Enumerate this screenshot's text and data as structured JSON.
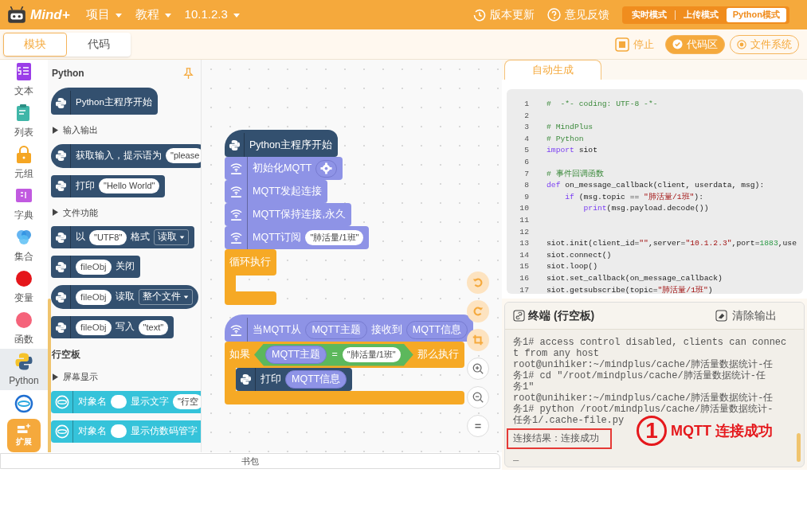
{
  "header": {
    "logo": "Mind+",
    "menus": [
      "项目",
      "教程",
      "10.1.2.3"
    ],
    "actions": [
      {
        "label": "版本更新",
        "kind": "update"
      },
      {
        "label": "意见反馈",
        "kind": "feedback"
      }
    ],
    "modes": [
      {
        "label": "实时模式",
        "selected": false
      },
      {
        "label": "上传模式",
        "selected": false
      },
      {
        "label": "Python模式",
        "selected": true
      }
    ]
  },
  "view_tabs": [
    {
      "label": "模块",
      "selected": true
    },
    {
      "label": "代码",
      "selected": false
    }
  ],
  "toolbar": [
    {
      "label": "停止",
      "kind": "stop",
      "selected": false
    },
    {
      "label": "代码区",
      "kind": "check",
      "selected": true
    },
    {
      "label": "文件系统",
      "kind": "radio",
      "selected": false
    }
  ],
  "categories": [
    {
      "label": "文本",
      "kind": "text",
      "selected": false
    },
    {
      "label": "列表",
      "kind": "list",
      "selected": false
    },
    {
      "label": "元组",
      "kind": "tuple",
      "selected": false
    },
    {
      "label": "字典",
      "kind": "dict",
      "selected": false
    },
    {
      "label": "集合",
      "kind": "set",
      "selected": false
    },
    {
      "label": "变量",
      "kind": "variable",
      "selected": false
    },
    {
      "label": "函数",
      "kind": "function",
      "selected": false
    },
    {
      "label": "Python",
      "kind": "python",
      "selected": true
    },
    {
      "kind": "unihiker",
      "selected": false
    },
    {
      "label": "扩展",
      "kind": "extension",
      "selected": false
    }
  ],
  "palette": [
    {
      "kind": "heading",
      "text": "Python",
      "pin": true
    },
    {
      "kind": "python-hat",
      "parts": [
        {
          "kind": "text",
          "text": "Python主程序开始"
        }
      ]
    },
    {
      "kind": "section",
      "text": "输入输出"
    },
    {
      "kind": "python-reporter",
      "parts": [
        {
          "kind": "text",
          "text": "获取输入，提示语为"
        },
        {
          "kind": "str",
          "text": "\"please"
        }
      ]
    },
    {
      "kind": "python-stack",
      "parts": [
        {
          "kind": "text",
          "text": "打印"
        },
        {
          "kind": "str",
          "text": "\"Hello World\""
        }
      ]
    },
    {
      "kind": "section",
      "text": "文件功能"
    },
    {
      "kind": "python-stack",
      "parts": [
        {
          "kind": "text",
          "text": "以"
        },
        {
          "kind": "str",
          "text": "\"UTF8\""
        },
        {
          "kind": "text",
          "text": "格式"
        },
        {
          "kind": "dropdown",
          "text": "读取"
        }
      ]
    },
    {
      "kind": "python-stack",
      "parts": [
        {
          "kind": "var",
          "text": "fileObj"
        },
        {
          "kind": "text",
          "text": "关闭"
        }
      ]
    },
    {
      "kind": "python-reporter",
      "parts": [
        {
          "kind": "var",
          "text": "fileObj"
        },
        {
          "kind": "text",
          "text": "读取"
        },
        {
          "kind": "dropdown",
          "text": "整个文件"
        }
      ]
    },
    {
      "kind": "python-stack",
      "parts": [
        {
          "kind": "var",
          "text": "fileObj"
        },
        {
          "kind": "text",
          "text": "写入"
        },
        {
          "kind": "str",
          "text": "\"text\""
        }
      ]
    },
    {
      "kind": "heading",
      "text": "行空板",
      "pin": false
    },
    {
      "kind": "section",
      "text": "屏幕显示"
    },
    {
      "kind": "unihiker-stack",
      "parts": [
        {
          "kind": "text",
          "text": "对象名"
        },
        {
          "kind": "slot"
        },
        {
          "kind": "text",
          "text": "显示文字"
        },
        {
          "kind": "str",
          "text": "\"行空"
        }
      ]
    },
    {
      "kind": "unihiker-stack",
      "parts": [
        {
          "kind": "text",
          "text": "对象名"
        },
        {
          "kind": "slot"
        },
        {
          "kind": "text",
          "text": "显示仿数码管字"
        }
      ]
    }
  ],
  "workspace": [
    [
      {
        "kind": "python-hat",
        "parts": [
          {
            "kind": "text",
            "text": "Python主程序开始"
          }
        ]
      },
      {
        "kind": "mqtt-stack",
        "parts": [
          {
            "kind": "text",
            "text": "初始化MQTT"
          },
          {
            "kind": "gear"
          }
        ]
      },
      {
        "kind": "mqtt-stack",
        "parts": [
          {
            "kind": "text",
            "text": "MQTT发起连接"
          }
        ]
      },
      {
        "kind": "mqtt-stack",
        "parts": [
          {
            "kind": "text",
            "text": "MQTT保持连接,永久"
          }
        ]
      },
      {
        "kind": "mqtt-stack",
        "parts": [
          {
            "kind": "text",
            "text": "MQTT订阅"
          },
          {
            "kind": "str",
            "text": "\"肺活量/1班\""
          }
        ]
      },
      {
        "kind": "control-c",
        "parts": [
          {
            "kind": "text",
            "text": "循环执行"
          }
        ]
      }
    ],
    [
      {
        "kind": "mqtt-hat",
        "parts": [
          {
            "kind": "text",
            "text": "当MQTT从"
          },
          {
            "kind": "mvar",
            "text": "MQTT主题"
          },
          {
            "kind": "text",
            "text": "接收到"
          },
          {
            "kind": "mvar",
            "text": "MQTT信息"
          }
        ]
      },
      {
        "kind": "control-c",
        "parts": [
          {
            "kind": "text",
            "text": "如果"
          },
          {
            "kind": "cond",
            "parts": [
              {
                "kind": "mvar",
                "text": "MQTT主题"
              },
              {
                "kind": "text",
                "text": "="
              },
              {
                "kind": "str",
                "text": "\"肺活量/1班\""
              }
            ]
          },
          {
            "kind": "text",
            "text": "那么执行"
          }
        ],
        "children": [
          {
            "kind": "python-stack",
            "parts": [
              {
                "kind": "text",
                "text": "打印"
              },
              {
                "kind": "mvar",
                "text": "MQTT信息"
              }
            ]
          }
        ]
      }
    ]
  ],
  "canvas_tools": [
    {
      "kind": "undo"
    },
    {
      "kind": "redo"
    },
    {
      "kind": "crop"
    },
    {
      "kind": "zoom-in"
    },
    {
      "kind": "zoom-out"
    },
    {
      "kind": "reset"
    }
  ],
  "code_panel": {
    "tab": "自动生成",
    "lines": [
      {
        "no": "1",
        "code": [
          {
            "text": "#  -*- coding: UTF-8 -*-",
            "kind": "cm"
          }
        ]
      },
      {
        "no": "2"
      },
      {
        "no": "3",
        "code": [
          {
            "text": "# MindPlus",
            "kind": "cm"
          }
        ]
      },
      {
        "no": "4",
        "code": [
          {
            "text": "# Python",
            "kind": "cm"
          }
        ]
      },
      {
        "no": "5",
        "code": [
          {
            "text": "import",
            "kind": "kw"
          },
          {
            "text": " siot"
          }
        ]
      },
      {
        "no": "6"
      },
      {
        "no": "7",
        "code": [
          {
            "text": "# 事件回调函数",
            "kind": "cm"
          }
        ]
      },
      {
        "no": "8",
        "code": [
          {
            "text": "def",
            "kind": "kw"
          },
          {
            "text": " on_message_callback(client, userdata, msg):"
          }
        ]
      },
      {
        "no": "9",
        "code": [
          {
            "text": "    if",
            "kind": "kw"
          },
          {
            "text": " (msg.topic == "
          },
          {
            "text": "\"肺活量/1班\"",
            "kind": "str"
          },
          {
            "text": "):"
          }
        ]
      },
      {
        "no": "10",
        "code": [
          {
            "text": "        print",
            "kind": "kw"
          },
          {
            "text": "(msg.payload.decode())"
          }
        ]
      },
      {
        "no": "11"
      },
      {
        "no": "12"
      },
      {
        "no": "13",
        "code": [
          {
            "text": "siot.init(client_id="
          },
          {
            "text": "\"\"",
            "kind": "str"
          },
          {
            "text": ",server="
          },
          {
            "text": "\"10.1.2.3\"",
            "kind": "str"
          },
          {
            "text": ",port="
          },
          {
            "text": "1883",
            "kind": "num"
          },
          {
            "text": ",use"
          }
        ]
      },
      {
        "no": "14",
        "code": [
          {
            "text": "siot.connect()"
          }
        ]
      },
      {
        "no": "15",
        "code": [
          {
            "text": "siot.loop()"
          }
        ]
      },
      {
        "no": "16",
        "code": [
          {
            "text": "siot.set_callback(on_message_callback)"
          }
        ]
      },
      {
        "no": "17",
        "code": [
          {
            "text": "siot.getsubscribe(topic="
          },
          {
            "text": "\"肺活量/1班\"",
            "kind": "str"
          },
          {
            "text": ")"
          }
        ]
      }
    ]
  },
  "terminal": {
    "title": "终端 (行空板)",
    "clear": "清除输出",
    "lines": [
      {
        "text": "务1# access control disabled, clients can connec",
        "highlighted": false
      },
      {
        "text": "t from any host",
        "highlighted": false
      },
      {
        "text": "root@unihiker:~/mindplus/cache/肺活量数据统计-任",
        "highlighted": false
      },
      {
        "text": "务1# cd \"/root/mindplus/cache/肺活量数据统计-任",
        "highlighted": false
      },
      {
        "text": "务1\"",
        "highlighted": false
      },
      {
        "text": "root@unihiker:~/mindplus/cache/肺活量数据统计-任",
        "highlighted": false
      },
      {
        "text": "务1# python /root/mindplus/cache/肺活量数据统计-",
        "highlighted": false
      },
      {
        "text": "任务1/.cache-file.py",
        "highlighted": false
      },
      {
        "text": "连接结果：连接成功",
        "highlighted": true
      },
      {
        "text": "_",
        "highlighted": false
      }
    ]
  },
  "annotation": {
    "marker": "1",
    "text": "MQTT 连接成功"
  },
  "backpack": "书包"
}
